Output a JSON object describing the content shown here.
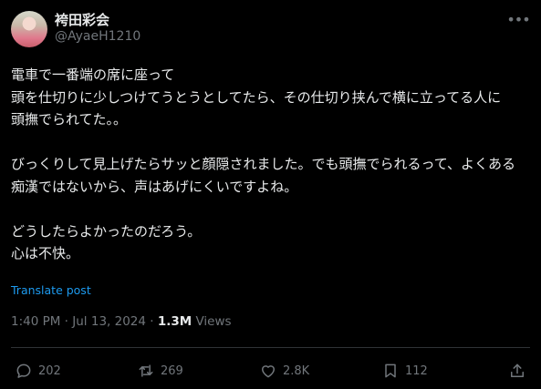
{
  "author": {
    "display_name": "袴田彩会",
    "handle": "@AyaeH1210"
  },
  "tweet": {
    "text": "電車で一番端の席に座って\n頭を仕切りに少しつけてうとうとしてたら、その仕切り挟んで横に立ってる人に\n頭撫でられてた。。\n\nびっくりして見上げたらサッと顔隠されました。でも頭撫でられるって、よくある痴漢ではないから、声はあげにくいですよね。\n\nどうしたらよかったのだろう。\n心は不快。",
    "translate_label": "Translate post",
    "timestamp": "1:40 PM · Jul 13, 2024",
    "separator": " · ",
    "views_count": "1.3M",
    "views_label": " Views"
  },
  "actions": {
    "reply_count": "202",
    "repost_count": "269",
    "like_count": "2.8K",
    "bookmark_count": "112"
  },
  "icons": {
    "more": "more-icon",
    "reply": "reply-icon",
    "repost": "repost-icon",
    "like": "heart-icon",
    "bookmark": "bookmark-icon",
    "share": "share-icon"
  },
  "colors": {
    "background": "#000000",
    "text": "#e7e9ea",
    "muted": "#71767b",
    "link": "#1d9bf0"
  }
}
